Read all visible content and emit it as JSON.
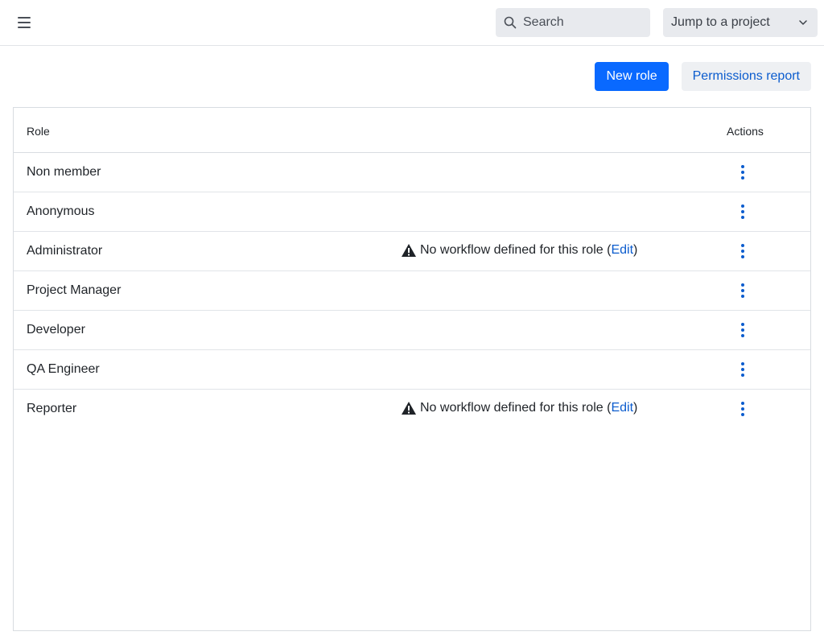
{
  "header": {
    "menu_icon": "hamburger-menu-icon",
    "search": {
      "placeholder": "Search",
      "value": "",
      "icon": "search-icon"
    },
    "project_jump": {
      "label": "Jump to a project",
      "icon": "chevron-down-icon"
    }
  },
  "toolbar": {
    "new_role_label": "New role",
    "permissions_report_label": "Permissions report"
  },
  "table": {
    "headers": {
      "role": "Role",
      "actions": "Actions"
    },
    "rows": [
      {
        "name": "Non member",
        "warning": null
      },
      {
        "name": "Anonymous",
        "warning": null
      },
      {
        "name": "Administrator",
        "warning": {
          "text": "No workflow defined for this role (",
          "link": "Edit",
          "suffix": ")"
        }
      },
      {
        "name": "Project Manager",
        "warning": null
      },
      {
        "name": "Developer",
        "warning": null
      },
      {
        "name": "QA Engineer",
        "warning": null
      },
      {
        "name": "Reporter",
        "warning": {
          "text": "No workflow defined for this role (",
          "link": "Edit",
          "suffix": ")"
        }
      }
    ]
  },
  "colors": {
    "primary": "#0969ff",
    "link": "#0b5cce",
    "input_bg": "#e8eaee",
    "border": "#d8dce1"
  }
}
